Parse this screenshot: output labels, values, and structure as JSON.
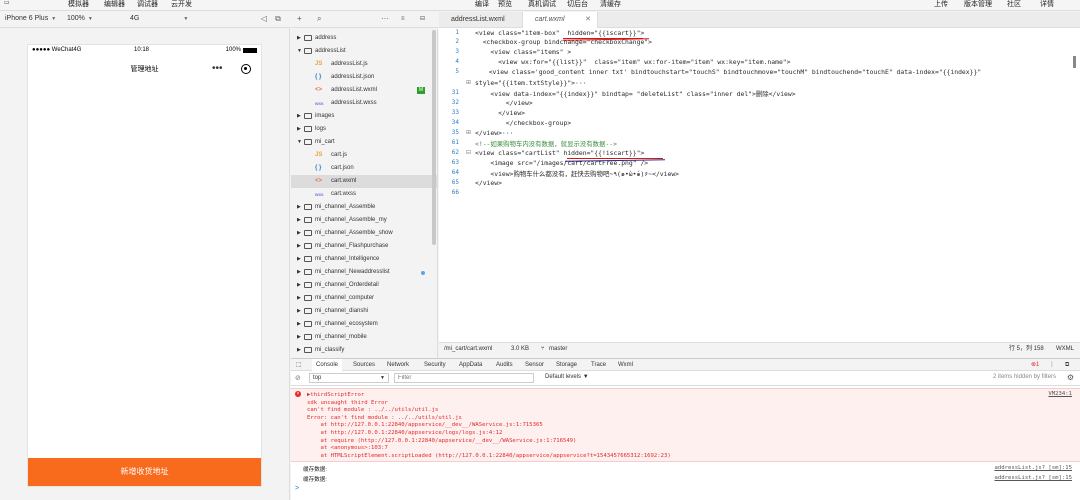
{
  "topbar": {
    "items": [
      "模拟器",
      "编辑器",
      "调试器",
      "云开发"
    ],
    "center_items": [
      "编译",
      "预览",
      "真机调试",
      "切后台",
      "清缓存"
    ],
    "right_items": [
      "上传",
      "版本管理",
      "社区",
      "详情"
    ]
  },
  "devicebar": {
    "device": "iPhone 6 Plus",
    "zoom": "100%",
    "network": "4G"
  },
  "phone": {
    "carrier": "●●●●● WeChat4G",
    "time": "10:18",
    "battery": "100%",
    "nav_title": "管理地址",
    "bottom_button": "新增收货地址"
  },
  "filetree": {
    "rows": [
      {
        "name": "address",
        "type": "folder",
        "open": false,
        "indent": 0
      },
      {
        "name": "addressList",
        "type": "folder",
        "open": true,
        "indent": 0
      },
      {
        "name": "addressList.js",
        "type": "js",
        "indent": 1
      },
      {
        "name": "addressList.json",
        "type": "json",
        "indent": 1
      },
      {
        "name": "addressList.wxml",
        "type": "wxml",
        "indent": 1,
        "badge": "M"
      },
      {
        "name": "addressList.wxss",
        "type": "wxss",
        "indent": 1
      },
      {
        "name": "images",
        "type": "folder",
        "open": false,
        "indent": 0
      },
      {
        "name": "logs",
        "type": "folder",
        "open": false,
        "indent": 0
      },
      {
        "name": "mi_cart",
        "type": "folder",
        "open": true,
        "indent": 0
      },
      {
        "name": "cart.js",
        "type": "js",
        "indent": 1
      },
      {
        "name": "cart.json",
        "type": "json",
        "indent": 1
      },
      {
        "name": "cart.wxml",
        "type": "wxml",
        "indent": 1,
        "active": true
      },
      {
        "name": "cart.wxss",
        "type": "wxss",
        "indent": 1
      },
      {
        "name": "mi_channel_Assemble",
        "type": "folder",
        "open": false,
        "indent": 0
      },
      {
        "name": "mi_channel_Assemble_my",
        "type": "folder",
        "open": false,
        "indent": 0
      },
      {
        "name": "mi_channel_Assemble_show",
        "type": "folder",
        "open": false,
        "indent": 0
      },
      {
        "name": "mi_channel_Flashpurchase",
        "type": "folder",
        "open": false,
        "indent": 0
      },
      {
        "name": "mi_channel_Intelligence",
        "type": "folder",
        "open": false,
        "indent": 0
      },
      {
        "name": "mi_channel_Newaddresslist",
        "type": "folder",
        "open": false,
        "indent": 0,
        "dot": true
      },
      {
        "name": "mi_channel_Orderdetail",
        "type": "folder",
        "open": false,
        "indent": 0
      },
      {
        "name": "mi_channel_computer",
        "type": "folder",
        "open": false,
        "indent": 0
      },
      {
        "name": "mi_channel_dianshi",
        "type": "folder",
        "open": false,
        "indent": 0
      },
      {
        "name": "mi_channel_ecosystem",
        "type": "folder",
        "open": false,
        "indent": 0
      },
      {
        "name": "mi_channel_mobile",
        "type": "folder",
        "open": false,
        "indent": 0
      },
      {
        "name": "mi_classify",
        "type": "folder",
        "open": false,
        "indent": 0
      }
    ]
  },
  "editor": {
    "tabs": [
      {
        "label": "addressList.wxml",
        "active": false
      },
      {
        "label": "cart.wxml",
        "active": true
      }
    ],
    "line_numbers": [
      "1",
      "2",
      "3",
      "4",
      "5",
      "",
      "31",
      "32",
      "33",
      "34",
      "35",
      "61",
      "62",
      "63",
      "64",
      "65",
      "66"
    ],
    "lines": {
      "l1": "<view class=\"item-box\"  hidden=\"{{iscart}}\">",
      "l2": "  <checkbox-group bindchange=\"checkboxChange\">",
      "l3": "    <view class=\"items\" >",
      "l4": "      <view wx:for=\"{{list}}\"  class=\"item\" wx:for-item=\"item\" wx:key=\"item.name\">",
      "l5": "  <view class='good_content inner txt' bindtouchstart=\"touchS\" bindtouchmove=\"touchM\" bindtouchend=\"touchE\" data-index=\"{{index}}\"",
      "l5b": "style=\"{{item.txtStyle}}\">···",
      "l31": "    <view data-index=\"{{index}}\" bindtap= \"deleteList\" class=\"inner del\">删除</view>",
      "l32": "        </view>",
      "l33": "      </view>",
      "l34": "        </checkbox-group>",
      "l35": "</view>···",
      "l61": "<!--如果购物车内没有数据，就显示没有数据-->",
      "l62": "<view class=\"cartList\" hidden=\"{{!iscart}}\">",
      "l63": "    <image src=\"/images/cart/cartFree.png\" />",
      "l64": "    <view>购物车什么都没有，赶快去购物吧~٩(๑•̀ω•́๑)۶~</view>",
      "l65": "</view>"
    },
    "status": {
      "path": "/mi_cart/cart.wxml",
      "size": "3.0 KB",
      "branch": "master",
      "position": "行 5，列 158",
      "lang": "WXML"
    }
  },
  "devtools": {
    "tabs": [
      "Console",
      "Sources",
      "Network",
      "Security",
      "AppData",
      "Audits",
      "Sensor",
      "Storage",
      "Trace",
      "Wxml"
    ],
    "active_tab": "Console",
    "error_count": "1",
    "context": "top",
    "filter_placeholder": "Filter",
    "levels": "Default levels",
    "hidden_info": "2 items hidden by filters",
    "error_lines": [
      "▶thirdScriptError",
      "sdk uncaught third Error",
      "can't find module : ../../utils/util.js",
      "Error: can't find module : ../../utils/util.js",
      "    at http://127.0.0.1:22840/appservice/__dev__/WAService.js:1:715365",
      "    at http://127.0.0.1:22840/appservice/logs/logs.js:4:12",
      "    at require (http://127.0.0.1:22840/appservice/__dev__/WAService.js:1:716549)",
      "    at <anonymous>:103:7",
      "    at HTMLScriptElement.scriptLoaded (http://127.0.0.1:22840/appservice/appservice?t=1543457665312:1692:23)"
    ],
    "error_source": "VM234:1",
    "logs": [
      {
        "text": "缓存数据:",
        "src": "addressList.js? [sm]:15"
      },
      {
        "text": "缓存数据:",
        "src": "addressList.js? [sm]:15"
      }
    ],
    "prompt": ">"
  },
  "colors": {
    "accent_orange": "#f86a1c",
    "error_red": "#e02a2a",
    "badge_green": "#2ca02c"
  }
}
